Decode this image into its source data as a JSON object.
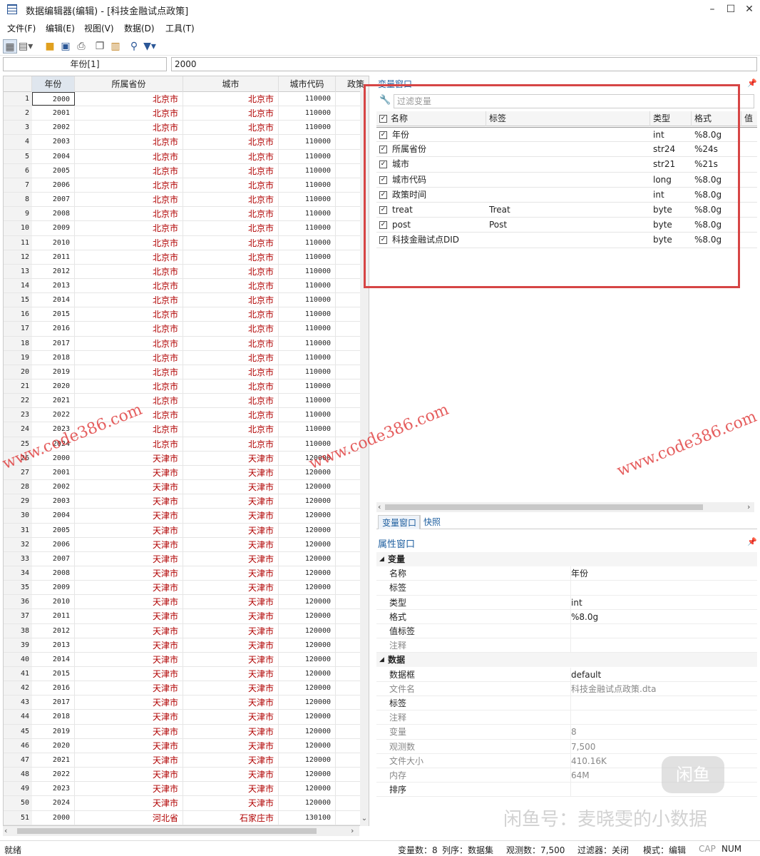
{
  "window": {
    "title": "数据编辑器(编辑) - [科技金融试点政策]"
  },
  "menu": [
    "文件(F)",
    "编辑(E)",
    "视图(V)",
    "数据(D)",
    "工具(T)"
  ],
  "toolbar_icons": [
    "browse-icon",
    "table-icon",
    "open-icon",
    "save-icon",
    "print-icon",
    "copy-icon",
    "paste-icon",
    "search-icon",
    "filter-icon"
  ],
  "varbox": "年份[1]",
  "valbox": "2000",
  "grid": {
    "columns": [
      "年份",
      "所属省份",
      "城市",
      "城市代码",
      "政策"
    ],
    "rows": [
      [
        "1",
        "2000",
        "北京市",
        "北京市",
        "110000"
      ],
      [
        "2",
        "2001",
        "北京市",
        "北京市",
        "110000"
      ],
      [
        "3",
        "2002",
        "北京市",
        "北京市",
        "110000"
      ],
      [
        "4",
        "2003",
        "北京市",
        "北京市",
        "110000"
      ],
      [
        "5",
        "2004",
        "北京市",
        "北京市",
        "110000"
      ],
      [
        "6",
        "2005",
        "北京市",
        "北京市",
        "110000"
      ],
      [
        "7",
        "2006",
        "北京市",
        "北京市",
        "110000"
      ],
      [
        "8",
        "2007",
        "北京市",
        "北京市",
        "110000"
      ],
      [
        "9",
        "2008",
        "北京市",
        "北京市",
        "110000"
      ],
      [
        "10",
        "2009",
        "北京市",
        "北京市",
        "110000"
      ],
      [
        "11",
        "2010",
        "北京市",
        "北京市",
        "110000"
      ],
      [
        "12",
        "2011",
        "北京市",
        "北京市",
        "110000"
      ],
      [
        "13",
        "2012",
        "北京市",
        "北京市",
        "110000"
      ],
      [
        "14",
        "2013",
        "北京市",
        "北京市",
        "110000"
      ],
      [
        "15",
        "2014",
        "北京市",
        "北京市",
        "110000"
      ],
      [
        "16",
        "2015",
        "北京市",
        "北京市",
        "110000"
      ],
      [
        "17",
        "2016",
        "北京市",
        "北京市",
        "110000"
      ],
      [
        "18",
        "2017",
        "北京市",
        "北京市",
        "110000"
      ],
      [
        "19",
        "2018",
        "北京市",
        "北京市",
        "110000"
      ],
      [
        "20",
        "2019",
        "北京市",
        "北京市",
        "110000"
      ],
      [
        "21",
        "2020",
        "北京市",
        "北京市",
        "110000"
      ],
      [
        "22",
        "2021",
        "北京市",
        "北京市",
        "110000"
      ],
      [
        "23",
        "2022",
        "北京市",
        "北京市",
        "110000"
      ],
      [
        "24",
        "2023",
        "北京市",
        "北京市",
        "110000"
      ],
      [
        "25",
        "2024",
        "北京市",
        "北京市",
        "110000"
      ],
      [
        "26",
        "2000",
        "天津市",
        "天津市",
        "120000"
      ],
      [
        "27",
        "2001",
        "天津市",
        "天津市",
        "120000"
      ],
      [
        "28",
        "2002",
        "天津市",
        "天津市",
        "120000"
      ],
      [
        "29",
        "2003",
        "天津市",
        "天津市",
        "120000"
      ],
      [
        "30",
        "2004",
        "天津市",
        "天津市",
        "120000"
      ],
      [
        "31",
        "2005",
        "天津市",
        "天津市",
        "120000"
      ],
      [
        "32",
        "2006",
        "天津市",
        "天津市",
        "120000"
      ],
      [
        "33",
        "2007",
        "天津市",
        "天津市",
        "120000"
      ],
      [
        "34",
        "2008",
        "天津市",
        "天津市",
        "120000"
      ],
      [
        "35",
        "2009",
        "天津市",
        "天津市",
        "120000"
      ],
      [
        "36",
        "2010",
        "天津市",
        "天津市",
        "120000"
      ],
      [
        "37",
        "2011",
        "天津市",
        "天津市",
        "120000"
      ],
      [
        "38",
        "2012",
        "天津市",
        "天津市",
        "120000"
      ],
      [
        "39",
        "2013",
        "天津市",
        "天津市",
        "120000"
      ],
      [
        "40",
        "2014",
        "天津市",
        "天津市",
        "120000"
      ],
      [
        "41",
        "2015",
        "天津市",
        "天津市",
        "120000"
      ],
      [
        "42",
        "2016",
        "天津市",
        "天津市",
        "120000"
      ],
      [
        "43",
        "2017",
        "天津市",
        "天津市",
        "120000"
      ],
      [
        "44",
        "2018",
        "天津市",
        "天津市",
        "120000"
      ],
      [
        "45",
        "2019",
        "天津市",
        "天津市",
        "120000"
      ],
      [
        "46",
        "2020",
        "天津市",
        "天津市",
        "120000"
      ],
      [
        "47",
        "2021",
        "天津市",
        "天津市",
        "120000"
      ],
      [
        "48",
        "2022",
        "天津市",
        "天津市",
        "120000"
      ],
      [
        "49",
        "2023",
        "天津市",
        "天津市",
        "120000"
      ],
      [
        "50",
        "2024",
        "天津市",
        "天津市",
        "120000"
      ],
      [
        "51",
        "2000",
        "河北省",
        "石家庄市",
        "130100"
      ]
    ]
  },
  "varwindow": {
    "title": "变量窗口",
    "filter_placeholder": "过滤变量",
    "headers": [
      "名称",
      "标签",
      "类型",
      "格式",
      "值标"
    ],
    "vars": [
      [
        "年份",
        "",
        "int",
        "%8.0g"
      ],
      [
        "所属省份",
        "",
        "str24",
        "%24s"
      ],
      [
        "城市",
        "",
        "str21",
        "%21s"
      ],
      [
        "城市代码",
        "",
        "long",
        "%8.0g"
      ],
      [
        "政策时间",
        "",
        "int",
        "%8.0g"
      ],
      [
        "treat",
        "Treat",
        "byte",
        "%8.0g"
      ],
      [
        "post",
        "Post",
        "byte",
        "%8.0g"
      ],
      [
        "科技金融试点DID",
        "",
        "byte",
        "%8.0g"
      ]
    ]
  },
  "tabs": [
    "变量窗口",
    "快照"
  ],
  "properties": {
    "title": "属性窗口",
    "sec_var": "变量",
    "sec_data": "数据",
    "var_rows": [
      [
        "名称",
        "年份"
      ],
      [
        "标签",
        ""
      ],
      [
        "类型",
        "int"
      ],
      [
        "格式",
        "%8.0g"
      ],
      [
        "值标签",
        ""
      ],
      [
        "注释",
        ""
      ]
    ],
    "data_rows": [
      [
        "数据框",
        "default"
      ],
      [
        "文件名",
        "科技金融试点政策.dta"
      ],
      [
        "标签",
        ""
      ],
      [
        "注释",
        ""
      ],
      [
        "变量",
        "8"
      ],
      [
        "观测数",
        "7,500"
      ],
      [
        "文件大小",
        "410.16K"
      ],
      [
        "内存",
        "64M"
      ],
      [
        "排序",
        ""
      ]
    ]
  },
  "status": {
    "ready": "就绪",
    "vars": "变量数：8",
    "order": "列序：数据集",
    "obs": "观测数：7,500",
    "filter": "过滤器：关闭",
    "mode": "模式：编辑",
    "cap": "CAP",
    "num": "NUM"
  },
  "watermarks": {
    "url": "www.code386.com",
    "fish": "闲鱼号：麦晓雯的小数据",
    "logo": "闲鱼"
  }
}
